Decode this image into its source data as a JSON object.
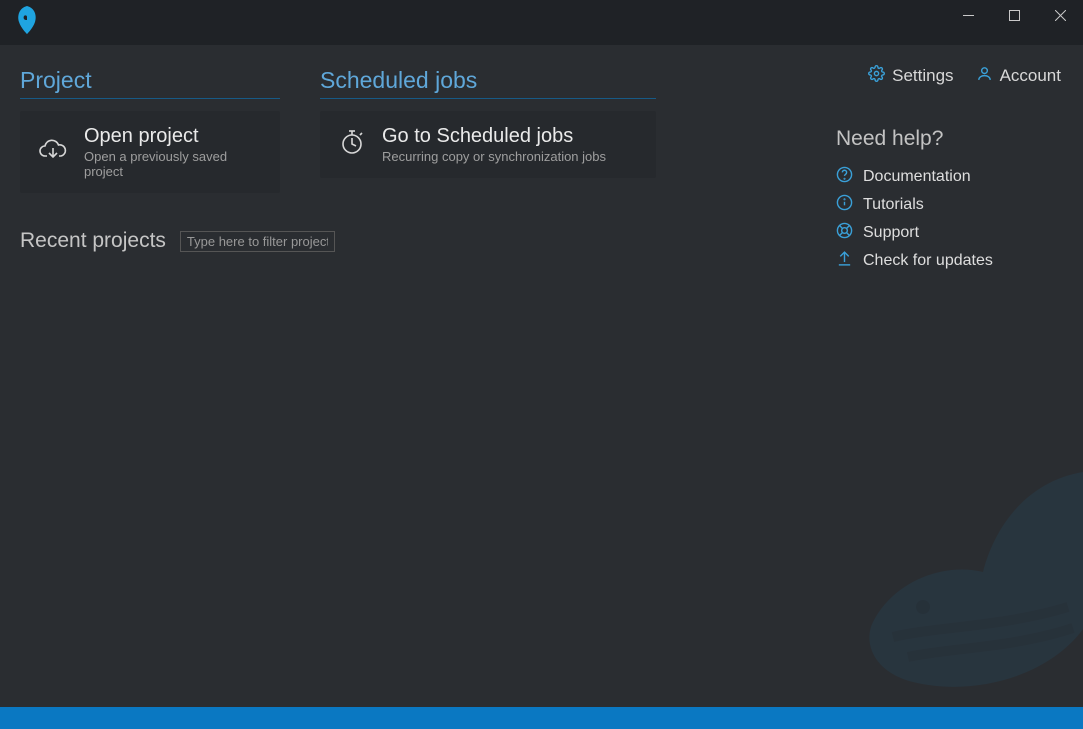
{
  "sections": {
    "project": {
      "title": "Project",
      "card": {
        "title": "Open project",
        "subtitle": "Open a previously saved project"
      }
    },
    "jobs": {
      "title": "Scheduled jobs",
      "card": {
        "title": "Go to Scheduled jobs",
        "subtitle": "Recurring copy or synchronization jobs"
      }
    },
    "recent": {
      "title": "Recent projects",
      "filter_placeholder": "Type here to filter projects"
    }
  },
  "topLinks": {
    "settings": "Settings",
    "account": "Account"
  },
  "help": {
    "title": "Need help?",
    "items": {
      "docs": "Documentation",
      "tutorials": "Tutorials",
      "support": "Support",
      "updates": "Check for updates"
    }
  }
}
